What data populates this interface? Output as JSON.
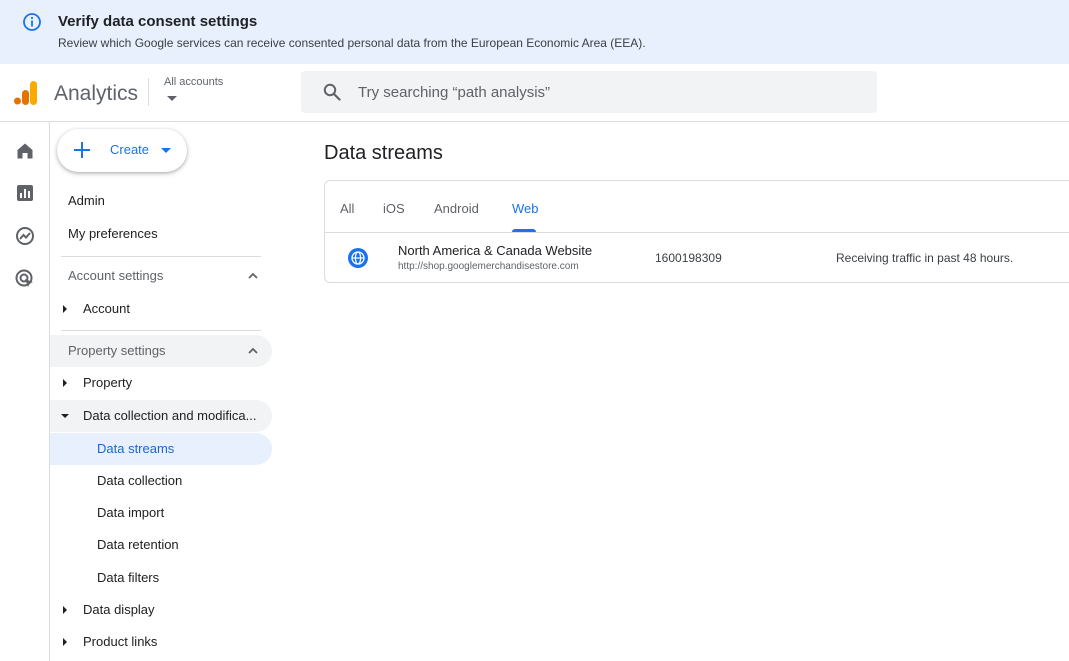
{
  "banner": {
    "title": "Verify data consent settings",
    "text": "Review which Google services can receive consented personal data from the European Economic Area (EEA)."
  },
  "header": {
    "app_name": "Analytics",
    "accounts_label": "All accounts",
    "search_placeholder": "Try searching “path analysis”"
  },
  "colors": {
    "accent": "#1a73e8",
    "banner_bg": "#e8f0fe",
    "logo_orange": "#f9ab00",
    "logo_dark_orange": "#e37400"
  },
  "rail": {
    "icons": [
      "home-icon",
      "reports-icon",
      "explore-icon",
      "advertising-icon"
    ]
  },
  "sidebar": {
    "create_label": "Create",
    "admin": "Admin",
    "my_preferences": "My preferences",
    "account_settings": "Account settings",
    "account": "Account",
    "property_settings": "Property settings",
    "property": "Property",
    "data_collection_mod": "Data collection and modifica...",
    "data_streams": "Data streams",
    "data_collection": "Data collection",
    "data_import": "Data import",
    "data_retention": "Data retention",
    "data_filters": "Data filters",
    "data_display": "Data display",
    "product_links": "Product links"
  },
  "main": {
    "title": "Data streams",
    "tabs": [
      "All",
      "iOS",
      "Android",
      "Web"
    ],
    "active_tab": "Web",
    "streams": [
      {
        "name": "North America & Canada Website",
        "url": "http://shop.googlemerchandisestore.com",
        "id": "1600198309",
        "status": "Receiving traffic in past 48 hours."
      }
    ]
  }
}
